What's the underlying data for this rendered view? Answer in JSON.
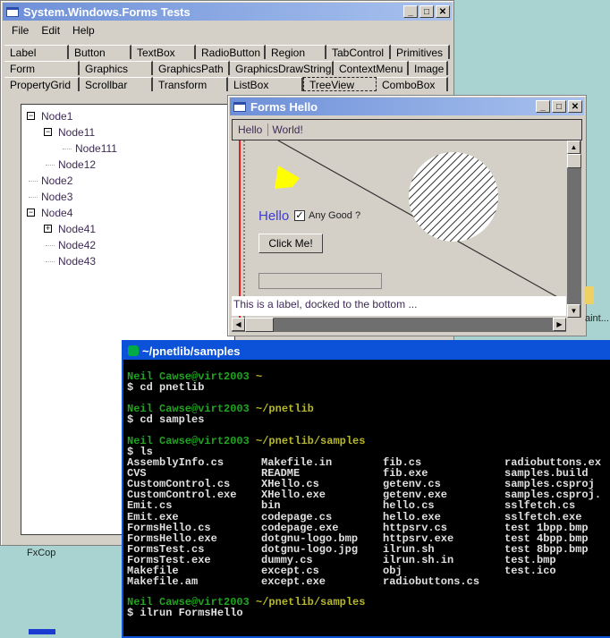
{
  "main_window": {
    "title": "System.Windows.Forms Tests",
    "menu": [
      "File",
      "Edit",
      "Help"
    ],
    "tab_rows": [
      [
        "Label",
        "Button",
        "TextBox",
        "RadioButton",
        "Region",
        "TabControl",
        "Primitives"
      ],
      [
        "Form",
        "Graphics",
        "GraphicsPath",
        "GraphicsDrawString",
        "ContextMenu",
        "Image"
      ],
      [
        "PropertyGrid",
        "Scrollbar",
        "Transform",
        "ListBox",
        "TreeView",
        "ComboBox"
      ]
    ],
    "active_tab": "TreeView",
    "tree": [
      {
        "label": "Node1",
        "level": 0,
        "toggle": "-"
      },
      {
        "label": "Node11",
        "level": 1,
        "toggle": "-"
      },
      {
        "label": "Node111",
        "level": 2,
        "toggle": ""
      },
      {
        "label": "Node12",
        "level": 1,
        "toggle": ""
      },
      {
        "label": "Node2",
        "level": 0,
        "toggle": ""
      },
      {
        "label": "Node3",
        "level": 0,
        "toggle": ""
      },
      {
        "label": "Node4",
        "level": 0,
        "toggle": "-"
      },
      {
        "label": "Node41",
        "level": 1,
        "toggle": "+"
      },
      {
        "label": "Node42",
        "level": 1,
        "toggle": ""
      },
      {
        "label": "Node43",
        "level": 1,
        "toggle": ""
      }
    ]
  },
  "hello_window": {
    "title": "Forms Hello",
    "menu": [
      "Hello",
      "World!"
    ],
    "hello_label": "Hello",
    "checkbox_label": "Any Good ?",
    "checkbox_checked": true,
    "button_label": "Click Me!",
    "textbox_value": "",
    "docked_label": "This is a label, docked to the bottom ..."
  },
  "terminal": {
    "title": "~/pnetlib/samples",
    "prompts": [
      {
        "user": "Neil Cawse@virt2003",
        "path": "~",
        "command": "$ cd pnetlib"
      },
      {
        "user": "Neil Cawse@virt2003",
        "path": "~/pnetlib",
        "command": "$ cd samples"
      },
      {
        "user": "Neil Cawse@virt2003",
        "path": "~/pnetlib/samples",
        "command": "$ ls"
      }
    ],
    "ls_columns": [
      [
        "AssemblyInfo.cs",
        "CVS",
        "CustomControl.cs",
        "CustomControl.exe",
        "Emit.cs",
        "Emit.exe",
        "FormsHello.cs",
        "FormsHello.exe",
        "FormsTest.cs",
        "FormsTest.exe",
        "Makefile",
        "Makefile.am"
      ],
      [
        "Makefile.in",
        "README",
        "XHello.cs",
        "XHello.exe",
        "bin",
        "codepage.cs",
        "codepage.exe",
        "dotgnu-logo.bmp",
        "dotgnu-logo.jpg",
        "dummy.cs",
        "except.cs",
        "except.exe"
      ],
      [
        "fib.cs",
        "fib.exe",
        "getenv.cs",
        "getenv.exe",
        "hello.cs",
        "hello.exe",
        "httpsrv.cs",
        "httpsrv.exe",
        "ilrun.sh",
        "ilrun.sh.in",
        "obj",
        "radiobuttons.cs"
      ],
      [
        "radiobuttons.ex",
        "samples.build",
        "samples.csproj",
        "samples.csproj.",
        "sslfetch.cs",
        "sslfetch.exe",
        "test 1bpp.bmp",
        "test 4bpp.bmp",
        "test 8bpp.bmp",
        "test.bmp",
        "test.ico"
      ]
    ],
    "last_prompt": {
      "user": "Neil Cawse@virt2003",
      "path": "~/pnetlib/samples",
      "command": "$ ilrun FormsHello"
    }
  },
  "desktop": {
    "icon_labels": [
      "FxCop",
      "aint..."
    ]
  }
}
